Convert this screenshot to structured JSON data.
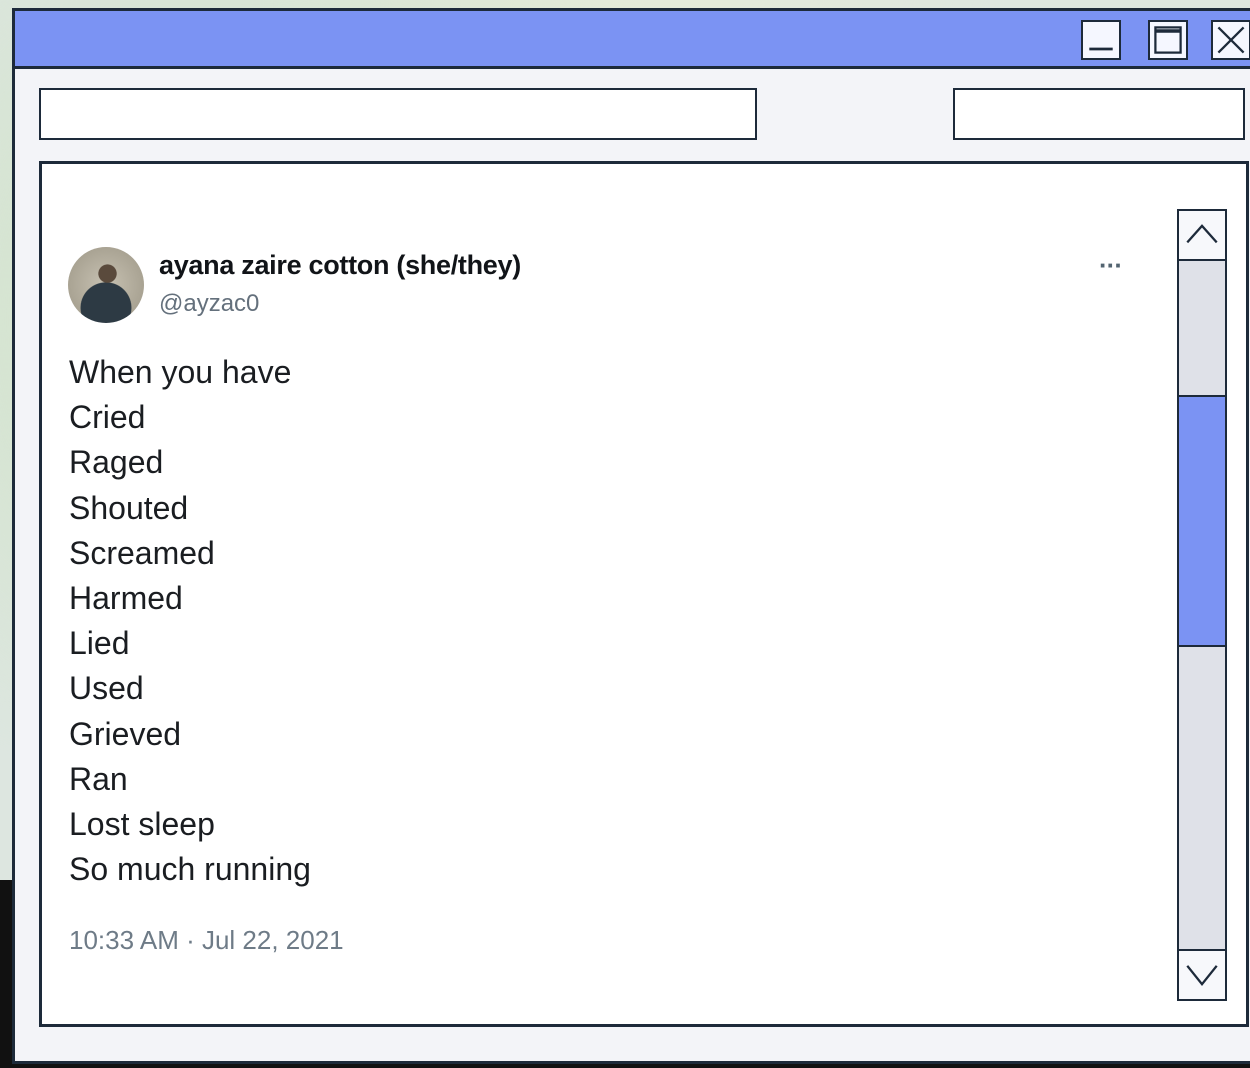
{
  "window": {
    "controls": [
      "minimize-icon",
      "maximize-icon",
      "close-icon"
    ]
  },
  "fields": {
    "left_value": "",
    "right_value": ""
  },
  "tweet": {
    "author_name": "ayana zaire cotton (she/they)",
    "handle": "@ayzac0",
    "more_label": "···",
    "lines": [
      "When you have",
      "Cried",
      "Raged",
      "Shouted",
      "Screamed",
      "Harmed",
      "Lied",
      "Used",
      "Grieved",
      "Ran",
      "Lost sleep",
      "So much running"
    ],
    "timestamp": "10:33 AM · Jul 22, 2021"
  },
  "colors": {
    "accent": "#7b93f3",
    "border": "#1d2a3a"
  }
}
